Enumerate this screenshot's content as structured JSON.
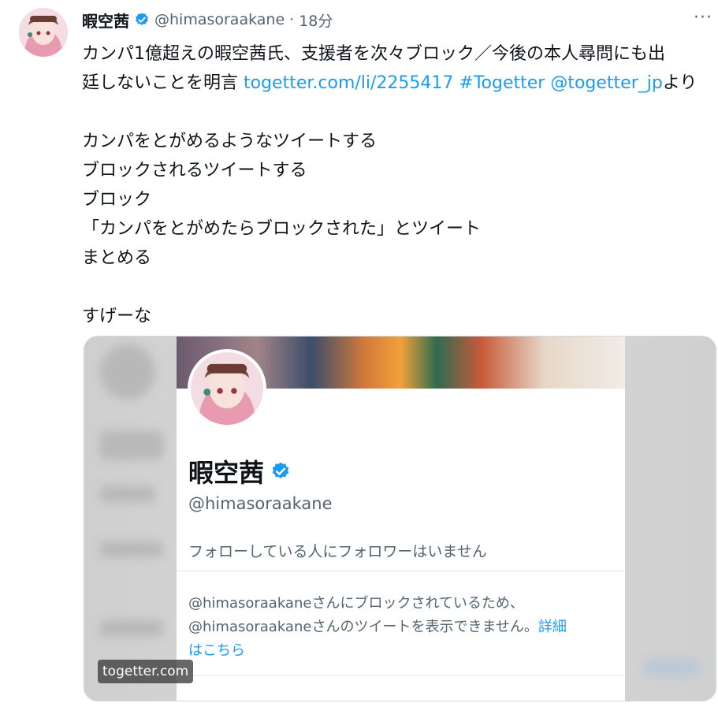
{
  "tweet": {
    "author_name": "暇空茜",
    "handle": "@himasoraakane",
    "separator": "·",
    "time": "18分",
    "more_label": "···",
    "lines": [
      {
        "text": "カンパ1億超えの暇空茜氏、支援者を次々ブロック／今後の本人尋問にも出"
      },
      {
        "text": "廷しないことを明言 ",
        "link1": "togetter.com/li/2255417",
        "link2": " #Togetter @togetter_jp",
        "tail": "より"
      }
    ],
    "para2": [
      "カンパをとがめるようなツイートする",
      "ブロックされるツイートする",
      "ブロック",
      "「カンパをとがめたらブロックされた」とツイート",
      "まとめる"
    ],
    "para3": "すげーな"
  },
  "card": {
    "profile_name": "暇空茜",
    "profile_handle": "@himasoraakane",
    "follow_note": "フォローしている人にフォロワーはいません",
    "blocked_line1": "@himasoraakaneさんにブロックされているため、",
    "blocked_line2": "@himasoraakaneさんのツイートを表示できません。",
    "detail_link1": "詳細",
    "detail_link2": "はこちら",
    "source": "togetter.com"
  },
  "colors": {
    "link": "#1d9bf0",
    "verified": "#1d9bf0",
    "muted": "#536471"
  }
}
